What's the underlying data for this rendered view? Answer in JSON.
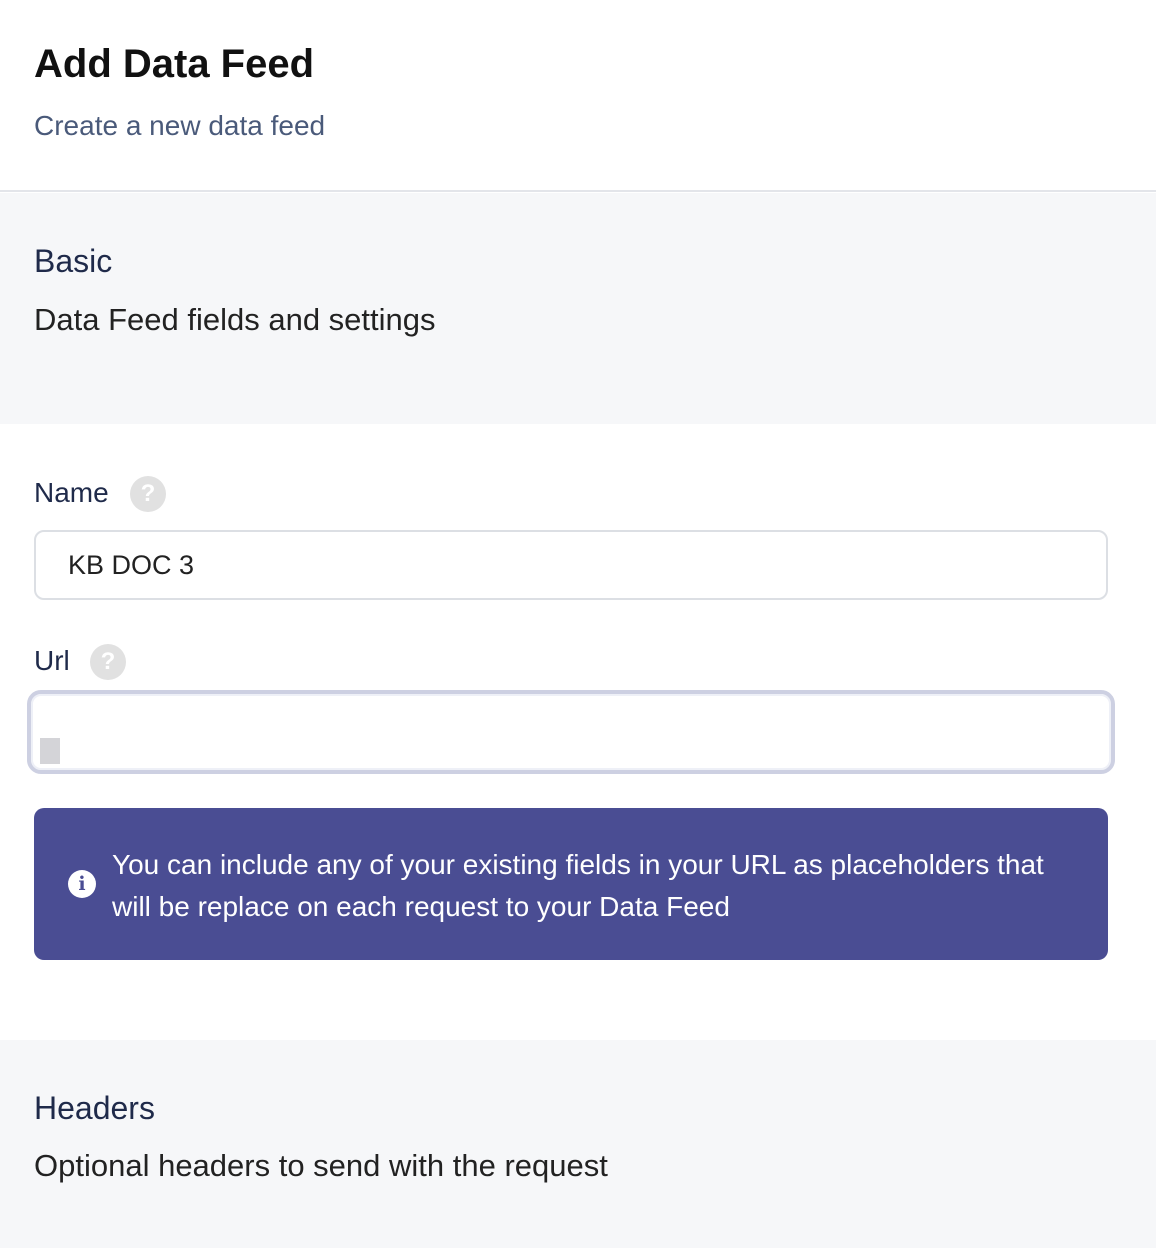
{
  "header": {
    "title": "Add Data Feed",
    "subtitle": "Create a new data feed"
  },
  "basic_section": {
    "title": "Basic",
    "description": "Data Feed fields and settings"
  },
  "form": {
    "name": {
      "label": "Name",
      "help_icon": "question-mark-icon",
      "value": "KB DOC 3"
    },
    "url": {
      "label": "Url",
      "help_icon": "question-mark-icon",
      "value": "",
      "focused": true
    }
  },
  "info_alert": {
    "icon": "info-icon",
    "text": "You can include any of your existing fields in your URL as placeholders that will be replace on each request to your Data Feed",
    "background_color": "#4a4d93"
  },
  "headers_section": {
    "title": "Headers",
    "description": "Optional headers to send with the request"
  }
}
